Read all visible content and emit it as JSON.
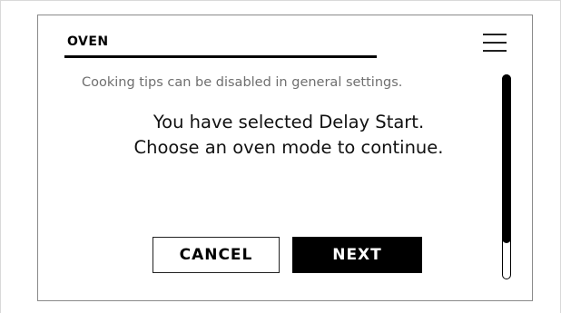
{
  "header": {
    "title": "OVEN"
  },
  "tip": {
    "text": "Cooking tips can be disabled in general settings."
  },
  "message": {
    "line1": "You have selected Delay Start.",
    "line2": "Choose an oven mode to continue."
  },
  "buttons": {
    "cancel_label": "CANCEL",
    "next_label": "NEXT"
  },
  "scrollbar": {
    "position": 0
  }
}
